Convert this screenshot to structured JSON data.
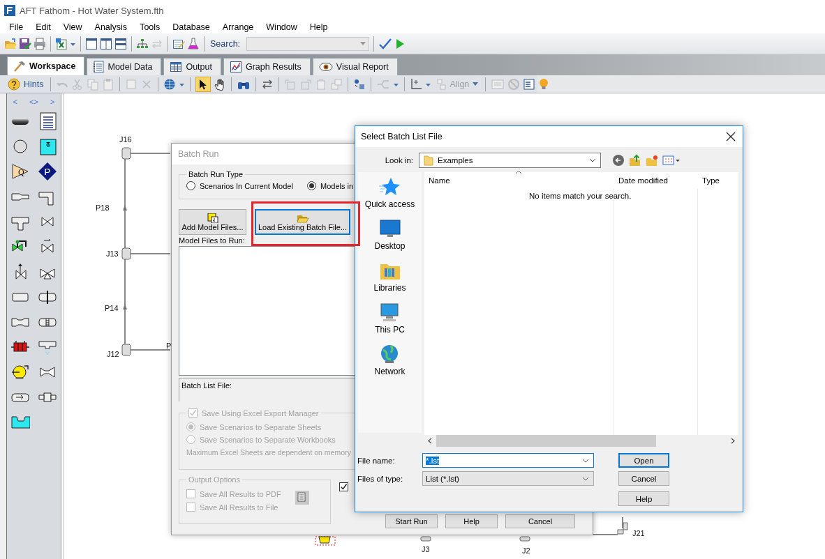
{
  "window": {
    "title": "AFT Fathom - Hot Water System.fth"
  },
  "menu": [
    "File",
    "Edit",
    "View",
    "Analysis",
    "Tools",
    "Database",
    "Arrange",
    "Window",
    "Help"
  ],
  "toolbar": {
    "search_label": "Search:"
  },
  "tabs": [
    {
      "label": "Workspace",
      "selected": true
    },
    {
      "label": "Model Data",
      "selected": false
    },
    {
      "label": "Output",
      "selected": false
    },
    {
      "label": "Graph Results",
      "selected": false
    },
    {
      "label": "Visual Report",
      "selected": false
    }
  ],
  "toolbar2": {
    "hints": "Hints",
    "align": "Align"
  },
  "palette": {
    "nav": [
      "<",
      "<>",
      ">"
    ],
    "flow_letter": "Q",
    "pressure_letter": "P"
  },
  "canvas": {
    "labels": [
      "J16",
      "P18",
      "J13",
      "P14",
      "J12",
      "P",
      "J3",
      "J2",
      "J21"
    ]
  },
  "batch_run": {
    "title": "Batch Run",
    "type_group": "Batch Run Type",
    "type_options": [
      {
        "label": "Scenarios In Current Model",
        "selected": false
      },
      {
        "label": "Models in",
        "selected": true
      }
    ],
    "buttons": [
      "Add Model Files...",
      "Load Existing Batch File..."
    ],
    "files_label": "Model Files to Run:",
    "batch_list_label": "Batch List File:",
    "excel": {
      "label": "Save Using Excel Export Manager",
      "checked": true,
      "disabled": true,
      "options": [
        {
          "label": "Save Scenarios to Separate Sheets",
          "selected": true
        },
        {
          "label": "Save Scenarios to Separate Workbooks",
          "selected": false
        }
      ],
      "note": "Maximum Excel Sheets are dependent on memory"
    },
    "output": {
      "title": "Output Options",
      "disabled": true,
      "options": [
        {
          "label": "Save All Results to PDF",
          "checked": false
        },
        {
          "label": "Save All Results to File",
          "checked": false
        }
      ]
    },
    "side_check": {
      "checked": true
    },
    "actions": [
      "Start Run",
      "Help",
      "Cancel"
    ]
  },
  "file_dialog": {
    "title": "Select Batch List File",
    "look_in_label": "Look in:",
    "look_in": "Examples",
    "places": [
      "Quick access",
      "Desktop",
      "Libraries",
      "This PC",
      "Network"
    ],
    "columns": [
      "Name",
      "Date modified",
      "Type"
    ],
    "empty_message": "No items match your search.",
    "file_name_label": "File name:",
    "file_name": "*.lst",
    "type_label": "Files of type:",
    "file_type": "List (*.lst)",
    "buttons": [
      "Open",
      "Cancel",
      "Help"
    ]
  }
}
